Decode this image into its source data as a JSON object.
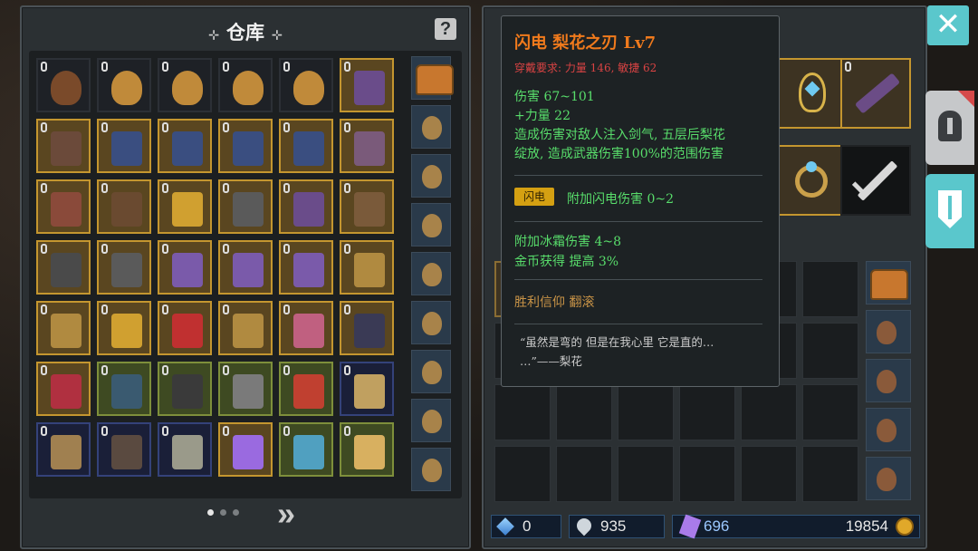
{
  "warehouse": {
    "title": "仓库",
    "title_deco": "⊹",
    "help_icon": "?",
    "page_dots": 3,
    "active_page": 0,
    "next_icon": "»"
  },
  "equipment": {
    "status": {
      "gems": "0",
      "hp": "935",
      "crystals": "696",
      "gold": "19854"
    }
  },
  "close_label": "✕",
  "tooltip": {
    "name": "闪电  梨花之刃  Lv7",
    "requirement": "穿戴要求:  力量 146, 敏捷 62",
    "damage": "伤害  67~101",
    "strength": "+力量  22",
    "effect_line1": "造成伤害对敌人注入剑气, 五层后梨花",
    "effect_line2": "绽放, 造成武器伤害100%的范围伤害",
    "tag": "闪电",
    "tag_effect": "附加闪电伤害  0~2",
    "frost": "附加冰霜伤害  4~8",
    "gold_gain": "金币获得  提高  3%",
    "belief": "胜利信仰    翻滚",
    "quote_line1": "“虽然是弯的  但是在我心里  它是直的…",
    "quote_line2": "…”——梨花"
  },
  "colors": {
    "accent_orange": "#f07a1c",
    "req_red": "#d94343",
    "stat_green": "#58dd6b",
    "close_cyan": "#5ac7cc"
  }
}
